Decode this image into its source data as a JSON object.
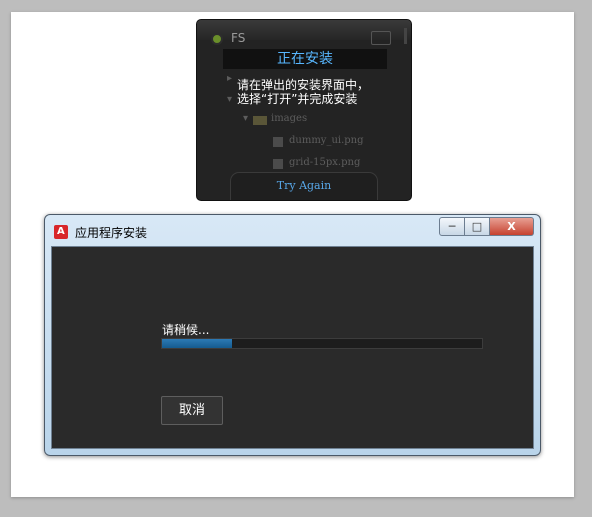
{
  "panel": {
    "app_name": "FS",
    "banner": "正在安装",
    "hint_line1": "请在弹出的安装界面中，",
    "hint_line2": "选择“打开”并完成安装",
    "tree": {
      "folder": "images",
      "files": [
        "dummy_ui.png",
        "grid-15px.png"
      ]
    },
    "try_again": "Try Again"
  },
  "window": {
    "title": "应用程序安装",
    "controls": {
      "minimize": "─",
      "maximize": "□",
      "close": "X"
    },
    "status": "请稍候...",
    "progress": 0.22,
    "cancel_label": "取消"
  }
}
